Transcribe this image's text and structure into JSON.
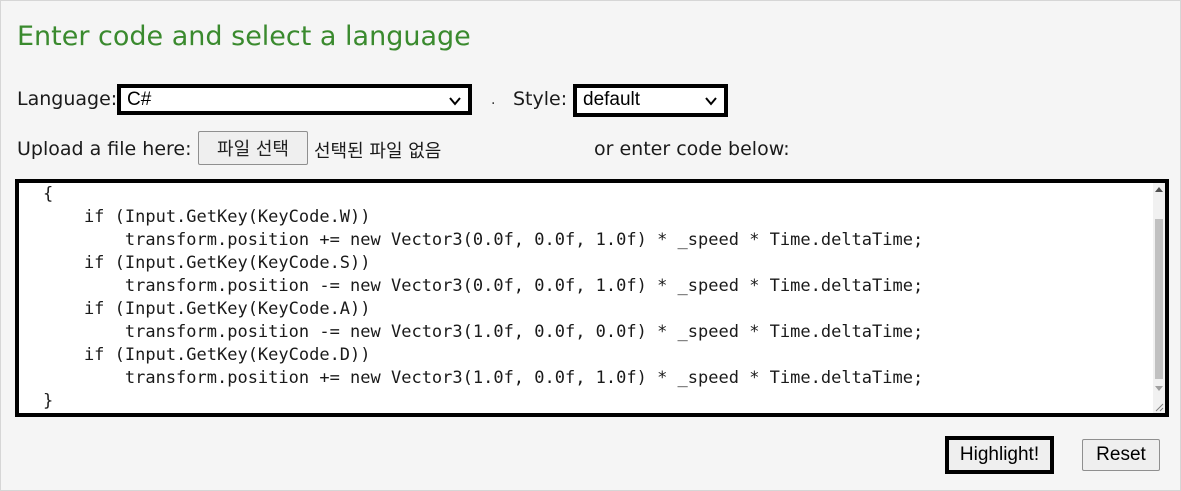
{
  "page": {
    "title": "Enter code and select a language",
    "accent_color": "#3a8a2e"
  },
  "form": {
    "language_label": "Language:",
    "language_value": "C#",
    "separator": "·",
    "style_label": "Style:",
    "style_value": "default",
    "upload_label": "Upload a file here:",
    "file_button_label": "파일 선택",
    "file_status": "선택된 파일 없음",
    "enter_code_label": "or enter code below:"
  },
  "code": {
    "lines": [
      "{",
      "    if (Input.GetKey(KeyCode.W))",
      "        transform.position += new Vector3(0.0f, 0.0f, 1.0f) * _speed * Time.deltaTime;",
      "    if (Input.GetKey(KeyCode.S))",
      "        transform.position -= new Vector3(0.0f, 0.0f, 1.0f) * _speed * Time.deltaTime;",
      "    if (Input.GetKey(KeyCode.A))",
      "        transform.position -= new Vector3(1.0f, 0.0f, 0.0f) * _speed * Time.deltaTime;",
      "    if (Input.GetKey(KeyCode.D))",
      "        transform.position += new Vector3(1.0f, 0.0f, 1.0f) * _speed * Time.deltaTime;",
      "}"
    ]
  },
  "actions": {
    "highlight_label": "Highlight!",
    "reset_label": "Reset"
  }
}
